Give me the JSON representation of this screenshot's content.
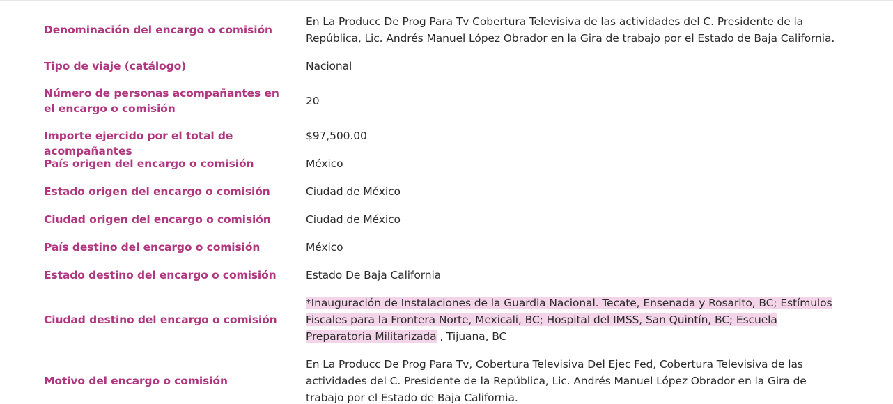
{
  "rows": [
    {
      "label": "Denominación del encargo o comisión",
      "value": "En La Producc De Prog Para Tv Cobertura Televisiva de las actividades del C. Presidente de la República, Lic. Andrés Manuel López Obrador en la Gira de trabajo por el Estado de Baja California."
    },
    {
      "label": "Tipo de viaje (catálogo)",
      "value": "Nacional"
    },
    {
      "label": "Número de personas acompañantes en el encargo o comisión",
      "value": "20"
    },
    {
      "label": "Importe ejercido por el total de acompañantes",
      "value": "$97,500.00"
    },
    {
      "label": "País origen del encargo o comisión",
      "value": "México"
    },
    {
      "label": "Estado origen del encargo o comisión",
      "value": "Ciudad de México"
    },
    {
      "label": "Ciudad origen del encargo o comisión",
      "value": "Ciudad de México"
    },
    {
      "label": "País destino del encargo o comisión",
      "value": "México"
    },
    {
      "label": "Estado destino del encargo o comisión",
      "value": "Estado De Baja California"
    },
    {
      "label": "Ciudad destino del encargo o comisión",
      "value_highlighted": "*Inauguración de Instalaciones de la Guardia Nacional. Tecate, Ensenada y Rosarito, BC; Estímulos Fiscales para la Frontera Norte, Mexicali, BC; Hospital del IMSS, San Quintín, BC; Escuela Preparatoria Militarizada",
      "value_rest": " , Tijuana, BC"
    },
    {
      "label": "Motivo del encargo o comisión",
      "value": "En La Producc De Prog Para Tv, Cobertura Televisiva Del Ejec Fed, Cobertura Televisiva de las actividades del C. Presidente de la República, Lic. Andrés Manuel López Obrador en la Gira de trabajo por el Estado de Baja California."
    }
  ],
  "colors": {
    "label": "#b0367f",
    "value": "#2b2b2b",
    "highlight": "#f4d4e8"
  }
}
